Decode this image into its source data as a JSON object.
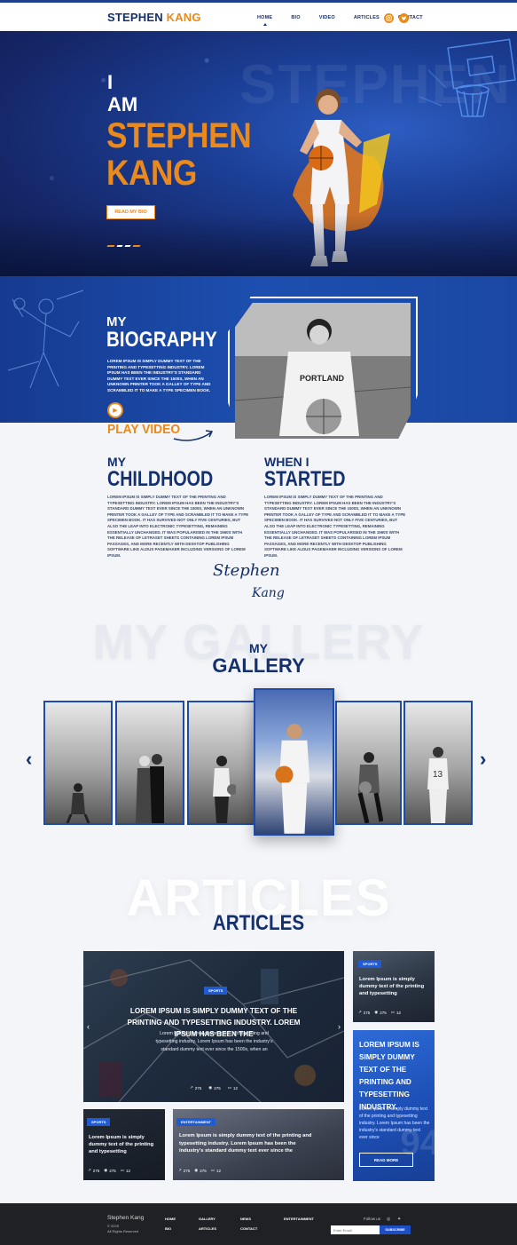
{
  "nav": {
    "logo_first": "STEPHEN",
    "logo_last": "KANG",
    "items": [
      {
        "label": "HOME",
        "active": true
      },
      {
        "label": "BIO"
      },
      {
        "label": "VIDEO"
      },
      {
        "label": "ARTICLES"
      },
      {
        "label": "CONTACT"
      }
    ],
    "social": [
      "instagram-icon",
      "twitter-icon"
    ],
    "accent": "#e98a19",
    "brand": "#14306e"
  },
  "hero": {
    "line1": "I",
    "line2": "AM",
    "name1": "STEPHEN",
    "name2": "KANG",
    "button": "READ MY BIO"
  },
  "bio": {
    "my": "MY",
    "title": "BIOGRAPHY",
    "text": "Lorem Ipsum is simply dummy text of the printing and typesetting industry. Lorem Ipsum has been the industry's standard dummy text ever since the 1500s, when an unknown printer took a galley of type and scrambled it to make a type specimen book.",
    "play": "PLAY VIDEO",
    "photo_text": "PORTLAND"
  },
  "childhood": {
    "my": "MY",
    "title": "CHILDHOOD",
    "text": "Lorem Ipsum is simply dummy text of the printing and typesetting industry. Lorem Ipsum has been the industry's standard dummy text ever since the 1500s, when an unknown printer took a galley of type and scrambled it to make a type specimen book. It has survived not only five centuries, but also the leap into electronic typesetting, remaining essentially unchanged. It was popularised in the 1960s with the release of Letraset sheets containing Lorem Ipsum passages, and more recently with desktop publishing software like Aldus PageMaker including versions of Lorem Ipsum."
  },
  "started": {
    "my": "WHEN I",
    "title": "STARTED",
    "text": "Lorem Ipsum is simply dummy text of the printing and typesetting industry. Lorem Ipsum has been the industry's standard dummy text ever since the 1500s, when an unknown printer took a galley of type and scrambled it to make a type specimen book. It has survived not only five centuries, but also the leap into electronic typesetting, remaining essentially unchanged. It was popularised in the 1960s with the release of Letraset sheets containing Lorem Ipsum passages, and more recently with desktop publishing software like Aldus PageMaker including versions of Lorem Ipsum."
  },
  "signature": {
    "line1": "Stephen",
    "line2": "Kang"
  },
  "gallery": {
    "ghost": "MY GALLERY",
    "my": "MY",
    "title": "GALLERY",
    "prev": "‹",
    "next": "›"
  },
  "articles": {
    "ghost": "ARTICLES",
    "title": "ARTICLES",
    "featured": {
      "tag": "SPORTS",
      "title": "LOREM IPSUM IS SIMPLY DUMMY TEXT OF THE PRINTING AND TYPESETTING INDUSTRY. LOREM IPSUM HAS BEEN THE",
      "desc": "Lorem Ipsum is simply dummy text of the printing and typesetting industry. Lorem Ipsum has been the industry's standard dummy text ever since the 1500s, when an",
      "views": "275",
      "likes": "275",
      "comments": "12"
    },
    "side_top": {
      "tag": "SPORTS",
      "title": "Lorem Ipsum is simply dummy text of the printing and typesetting",
      "views": "275",
      "likes": "275",
      "comments": "12"
    },
    "side_blue": {
      "title": "LOREM IPSUM IS SIMPLY DUMMY TEXT OF THE PRINTING AND TYPESETTING INDUSTRY.",
      "desc": "Lorem Ipsum is simply dummy text of the printing and typesetting industry. Lorem Ipsum has been the industry's standard dummy text ever since",
      "button": "READ MORE"
    },
    "small_left": {
      "tag": "SPORTS",
      "title": "Lorem Ipsum is simply dummy text of the printing and typesetting",
      "views": "275",
      "likes": "275",
      "comments": "12"
    },
    "small_mid": {
      "tag": "ENTERTAINMENT",
      "title": "Lorem Ipsum is simply dummy text of the printing and typesetting industry. Lorem Ipsum has been the industry's standard dummy text ever since the",
      "views": "275",
      "likes": "275",
      "comments": "12"
    }
  },
  "footer": {
    "logo": "Stephen Kang",
    "copy1": "© 2025",
    "copy2": "All Rights Reserved",
    "links": [
      "HOME",
      "GALLERY",
      "NEWS",
      "ENTERTAINMENT",
      "BIO",
      "ARTICLES",
      "CONTACT"
    ],
    "follow": "Follow us",
    "email_placeholder": "Enter Email",
    "subscribe": "SUBSCRIBE"
  }
}
